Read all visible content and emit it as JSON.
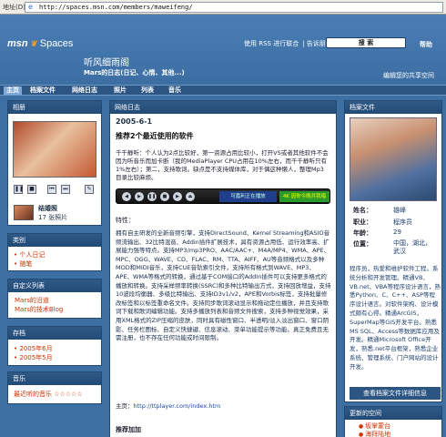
{
  "browser": {
    "address_label": "地址(D)",
    "url": "http://spaces.msn.com/members/maweifeng/"
  },
  "header": {
    "logo_msn": "msn",
    "logo_spaces": "Spaces",
    "blog_title": "听风细雨阁",
    "blog_subtitle": "Mars的日志(日记、心情、其他...)",
    "links": [
      "使用 RSS 进行联合",
      "告诉朋友"
    ],
    "search_label": "搜 索",
    "help": "帮助",
    "spaces_link": "编辑您的共享空间"
  },
  "nav": {
    "items": [
      "主页",
      "档案文件",
      "网络日志",
      "照片",
      "列表",
      "音乐"
    ],
    "active": "主页"
  },
  "left": {
    "photo_panel_title": "相册",
    "photo_controls": [
      "❚❚",
      "■",
      "⏮",
      "⏭",
      "✎"
    ],
    "album_name": "结婚照",
    "album_count": "17 张照片",
    "categories_title": "类别",
    "categories": [
      "个人日记",
      "随笔"
    ],
    "custom_title": "自定义列表",
    "custom_list": [
      "Mars的沿道",
      "Mars的技术Blog"
    ],
    "archive_title": "存档",
    "archive": [
      "2005年6月",
      "2005年5月"
    ],
    "music_title": "音乐",
    "music_item": "最近听的音乐 ☆☆☆☆☆"
  },
  "center": {
    "panel_title": "网络日志",
    "post_date": "2005-6-1",
    "post_title": "推荐2个最近使用的软件",
    "intro": "千千静听：个人认为2点比较好，第一资源占用比较小，打开VS或者其他软件不会因为听音乐而加卡断（我的MediaPlayer CPU占用在10%左右，而千千静听只有1%左右）；第二，支持歌词。缺点是不支持媒体库，对于偶这种懒人，整理Mp3目录比较麻烦。",
    "player_lcd1": "可嘉利正在播放",
    "player_lcd2": "4K 因你今晚共我唱",
    "features_label": "特性：",
    "features": "拥有自主研发的全新音频引擎，支持DirectSound、Kernel Streaming和ASIO音频流输出、32比特混音、Addin插件扩展技术，具有资源占用低、运行效率高、扩展能力强等特点。支持MP3/mp3PRO、AAC/AAC+、M4A/MP4、WMA、APE、MPC、OGG、WAVE、CD、FLAC、RM、TTA、AIFF、AU等音频格式以及多种MOD和MIDI音乐，支持CUE音轨索引文件，支持所有格式到WAVE、MP3、APE、WMA等格式的转换，通过基于COM接口的AddIn插件可以支持更多格式的播放和转换。支持采样频率转换(SSRC)和多种比特输出方式，支持回放增益，支持10波段均衡器、多级比特输出、支持ID3v1/v2，APE和Vorbis标签，支持批量修改标签和以标签重命名文件。支持同步歌词滚动显示和拖动定位播放，并且支持歌词下载和歌词编辑功能。支持多播放列表和音频文件搜索，支持多种视觉效果，采用XML格式的ZIP压缩的皮肤，同时具有磁性窗口、半透明/淡入淡出窗口、窗口阴影、任务栏图标、自定义快捷键、信息滚动、菜单功能提示等功能。真正免费且无需注册，也不存在任何功能或时间限制。",
    "home_label": "主页：",
    "home_url": "http://ttplayer.com/index.htm",
    "recommend": "推荐加加"
  },
  "right": {
    "profile_title": "档案文件",
    "profile_fields": [
      {
        "k": "姓名：",
        "v": "雄峰"
      },
      {
        "k": "职业：",
        "v": "程序员"
      },
      {
        "k": "年龄：",
        "v": "29"
      },
      {
        "k": "位置：",
        "v": "中国，湖北，武汉"
      }
    ],
    "bio": "程序员，热爱和维护软件工程。系统分析和开发管理。精通VB、VB.net、VBA等程序设计语言，熟悉Python、C、C++、ASP等程序设计语言。对软件架构、设计模式颇有心得。精通ArcGIS，SuperMap等GIS开发平台。熟悉MS SQL、Access等数据库应用及开发。精通Microsoft Office开发，熟悉.net平台框架，熟悉企业系统、管理系统、门户网站的设计开发。",
    "full_profile": "查看档案文件详细信息",
    "updates_title": "更新的空间",
    "contacts": [
      "坂掌蒙台",
      "海拜陆地"
    ]
  }
}
